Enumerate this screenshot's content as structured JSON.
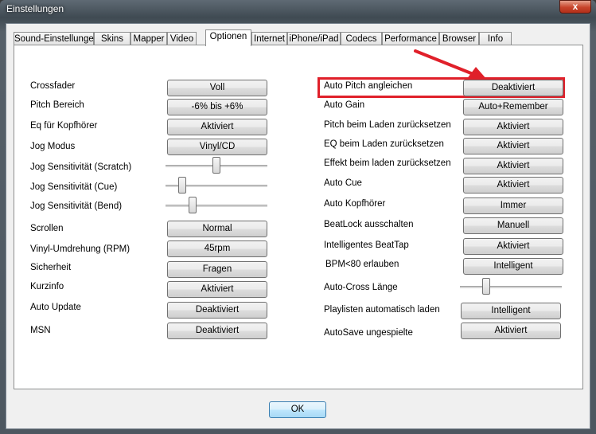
{
  "window": {
    "title": "Einstellungen",
    "close_label": "x"
  },
  "tabs": [
    {
      "label": "Sound-Einstellungen"
    },
    {
      "label": "Skins"
    },
    {
      "label": "Mapper"
    },
    {
      "label": "Video"
    },
    {
      "label": "Optionen"
    },
    {
      "label": "Internet"
    },
    {
      "label": "iPhone/iPad"
    },
    {
      "label": "Codecs"
    },
    {
      "label": "Performance"
    },
    {
      "label": "Browser"
    },
    {
      "label": "Info"
    }
  ],
  "active_tab": "Optionen",
  "left": {
    "crossfader": {
      "label": "Crossfader",
      "value": "Voll"
    },
    "pitch_bereich": {
      "label": "Pitch Bereich",
      "value": "-6% bis +6%"
    },
    "eq_kopfhoerer": {
      "label": "Eq für Kopfhörer",
      "value": "Aktiviert"
    },
    "jog_modus": {
      "label": "Jog Modus",
      "value": "Vinyl/CD"
    },
    "jog_scratch": {
      "label": "Jog Sensitivität (Scratch)"
    },
    "jog_cue": {
      "label": "Jog Sensitivität (Cue)"
    },
    "jog_bend": {
      "label": "Jog Sensitivität (Bend)"
    },
    "scrollen": {
      "label": "Scrollen",
      "value": "Normal"
    },
    "vinyl_umdrehung": {
      "label": "Vinyl-Umdrehung (RPM)",
      "value": "45rpm"
    },
    "sicherheit": {
      "label": "Sicherheit",
      "value": "Fragen"
    },
    "kurzinfo": {
      "label": "Kurzinfo",
      "value": "Aktiviert"
    },
    "auto_update": {
      "label": "Auto Update",
      "value": "Deaktiviert"
    },
    "msn": {
      "label": "MSN",
      "value": "Deaktiviert"
    }
  },
  "right": {
    "auto_pitch": {
      "label": "Auto Pitch angleichen",
      "value": "Deaktiviert"
    },
    "auto_gain": {
      "label": "Auto Gain",
      "value": "Auto+Remember"
    },
    "pitch_reset": {
      "label": "Pitch beim Laden zurücksetzen",
      "value": "Aktiviert"
    },
    "eq_reset": {
      "label": "EQ beim Laden zurücksetzen",
      "value": "Aktiviert"
    },
    "effekt_reset": {
      "label": "Effekt beim laden zurücksetzen",
      "value": "Aktiviert"
    },
    "auto_cue": {
      "label": "Auto Cue",
      "value": "Aktiviert"
    },
    "auto_kopfhoerer": {
      "label": "Auto Kopfhörer",
      "value": "Immer"
    },
    "beatlock": {
      "label": "BeatLock ausschalten",
      "value": "Manuell"
    },
    "beattap": {
      "label": "Intelligentes BeatTap",
      "value": "Aktiviert"
    },
    "bpm80": {
      "label": "BPM<80 erlauben",
      "value": "Intelligent"
    },
    "auto_cross": {
      "label": "Auto-Cross Länge"
    },
    "playlisten": {
      "label": "Playlisten automatisch laden",
      "value": "Intelligent"
    },
    "autosave": {
      "label": "AutoSave ungespielte",
      "value": "Aktiviert"
    }
  },
  "footer": {
    "ok_label": "OK"
  },
  "colors": {
    "highlight": "#e0202a",
    "ok_accent": "#3c7fb1"
  }
}
